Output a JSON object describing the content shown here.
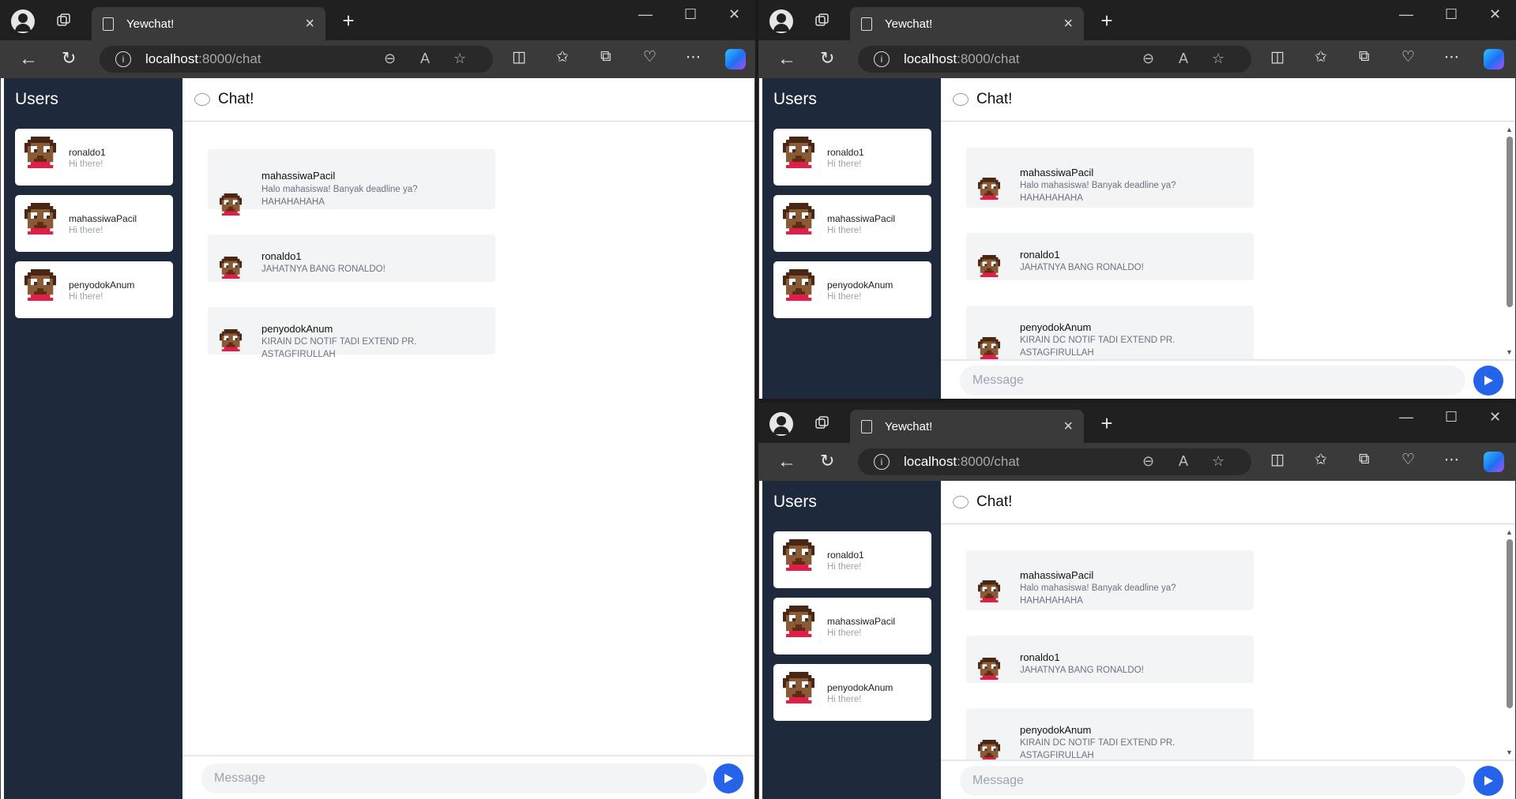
{
  "browser": {
    "tab_title": "Yewchat!",
    "url_host": "localhost",
    "url_rest": ":8000/chat"
  },
  "app": {
    "sidebar_title": "Users",
    "chat_title": "Chat!",
    "message_placeholder": "Message",
    "users": [
      {
        "name": "ronaldo1",
        "status": "Hi there!"
      },
      {
        "name": "mahassiwaPacil",
        "status": "Hi there!"
      },
      {
        "name": "penyodokAnum",
        "status": "Hi there!"
      }
    ],
    "messages": [
      {
        "from": "mahassiwaPacil",
        "text": "Halo mahasiswa! Banyak deadline ya? HAHAHAHAHA"
      },
      {
        "from": "ronaldo1",
        "text": "JAHATNYA BANG RONALDO!"
      },
      {
        "from": "penyodokAnum",
        "text": "KIRAIN DC NOTIF TADI EXTEND PR. ASTAGFIRULLAH"
      }
    ]
  },
  "colors": {
    "sidebar_bg": "#1e293b",
    "send_button": "#2563eb",
    "message_bg": "#f3f4f6"
  }
}
